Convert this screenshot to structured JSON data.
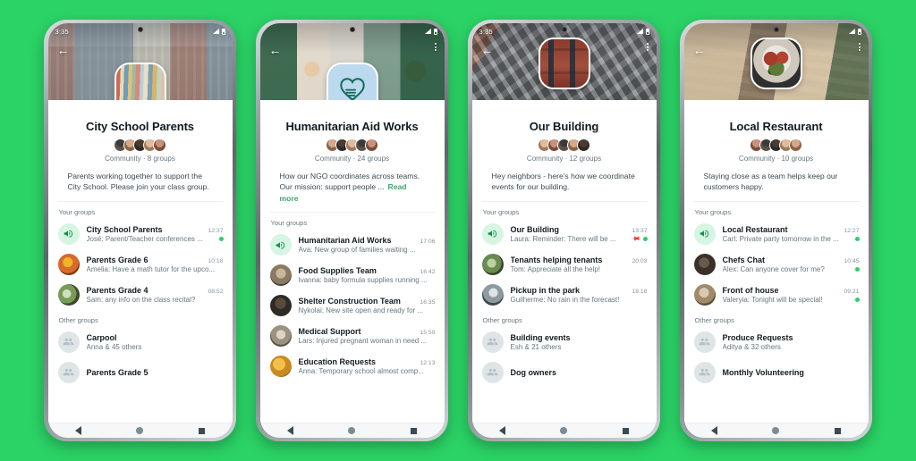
{
  "theme": {
    "background_green": "#2BD366",
    "accent_green": "#25D366",
    "link_green": "#3ca66f",
    "title_color": "#111b21",
    "secondary_text": "#667781"
  },
  "phones": [
    {
      "status": {
        "time": "3:35"
      },
      "community": {
        "title": "City School Parents",
        "meta": "Community · 8 groups",
        "description": "Parents working together to support the City School. Please join your class group.",
        "read_more": "",
        "avatar_icon": "books-cover-photo",
        "cover_icon": "school-building-photo"
      },
      "sections": [
        {
          "label": "Your groups",
          "rows": [
            {
              "title": "City School Parents",
              "time": "12:37",
              "subtitle": "José: Parent/Teacher conferences ...",
              "avatar": "announcement-megaphone-icon",
              "pinned": false,
              "unread": true
            },
            {
              "title": "Parents Grade 6",
              "time": "10:18",
              "subtitle": "Amelia: Have a math tutor for the upco...",
              "avatar": "group-photo",
              "pinned": false,
              "unread": false
            },
            {
              "title": "Parents Grade 4",
              "time": "08:52",
              "subtitle": "Sam: any info on the class recital?",
              "avatar": "group-photo",
              "pinned": false,
              "unread": false
            }
          ]
        },
        {
          "label": "Other groups",
          "rows": [
            {
              "title": "Carpool",
              "time": "",
              "subtitle": "Anna & 45 others",
              "avatar": "group-placeholder-icon",
              "pinned": false,
              "unread": false
            },
            {
              "title": "Parents Grade 5",
              "time": "",
              "subtitle": "",
              "avatar": "group-placeholder-icon",
              "pinned": false,
              "unread": false
            }
          ]
        }
      ]
    },
    {
      "status": {
        "time": ""
      },
      "community": {
        "title": "Humanitarian Aid Works",
        "meta": "Community · 24 groups",
        "description": "How our NGO coordinates across teams. Our mission: support people ...",
        "read_more": "Read more",
        "avatar_icon": "heart-hand-logo",
        "cover_icon": "volunteers-photo"
      },
      "sections": [
        {
          "label": "Your groups",
          "rows": [
            {
              "title": "Humanitarian Aid Works",
              "time": "17:06",
              "subtitle": "Ava: New group of families waiting ...",
              "avatar": "announcement-megaphone-icon",
              "pinned": false,
              "unread": false
            },
            {
              "title": "Food Supplies Team",
              "time": "16:42",
              "subtitle": "Ivanna: baby formula supplies running ...",
              "avatar": "group-photo",
              "pinned": false,
              "unread": false
            },
            {
              "title": "Shelter Construction Team",
              "time": "16:35",
              "subtitle": "Nykolai: New site open and ready for ...",
              "avatar": "group-photo",
              "pinned": false,
              "unread": false
            },
            {
              "title": "Medical Support",
              "time": "15:59",
              "subtitle": "Lars: Injured pregnant woman in need ...",
              "avatar": "group-photo",
              "pinned": false,
              "unread": false
            },
            {
              "title": "Education Requests",
              "time": "12:13",
              "subtitle": "Anna: Temporary school almost comp...",
              "avatar": "group-photo",
              "pinned": false,
              "unread": false
            }
          ]
        }
      ]
    },
    {
      "status": {
        "time": "3:35"
      },
      "community": {
        "title": "Our Building",
        "meta": "Community · 12 groups",
        "description": "Hey neighbors - here's how we coordinate events for our building.",
        "read_more": "",
        "avatar_icon": "brick-building-photo",
        "cover_icon": "aerial-city-photo"
      },
      "sections": [
        {
          "label": "Your groups",
          "rows": [
            {
              "title": "Our Building",
              "time": "13:37",
              "subtitle": "Laura: Reminder: There will be ...",
              "avatar": "announcement-megaphone-icon",
              "pinned": true,
              "unread": true
            },
            {
              "title": "Tenants helping tenants",
              "time": "20:03",
              "subtitle": "Tom: Appreciate all the help!",
              "avatar": "group-photo",
              "pinned": false,
              "unread": false
            },
            {
              "title": "Pickup in the park",
              "time": "18:18",
              "subtitle": "Guilherme: No rain in the forecast!",
              "avatar": "group-photo",
              "pinned": false,
              "unread": false
            }
          ]
        },
        {
          "label": "Other groups",
          "rows": [
            {
              "title": "Building events",
              "time": "",
              "subtitle": "Esh & 21 others",
              "avatar": "group-placeholder-icon",
              "pinned": false,
              "unread": false
            },
            {
              "title": "Dog owners",
              "time": "",
              "subtitle": "",
              "avatar": "group-placeholder-icon",
              "pinned": false,
              "unread": false
            }
          ]
        }
      ]
    },
    {
      "status": {
        "time": ""
      },
      "community": {
        "title": "Local Restaurant",
        "meta": "Community · 10 groups",
        "description": "Staying close as a team helps keep our customers happy.",
        "read_more": "",
        "avatar_icon": "plated-food-photo",
        "cover_icon": "restaurant-interior-photo"
      },
      "sections": [
        {
          "label": "Your groups",
          "rows": [
            {
              "title": "Local Restaurant",
              "time": "12:27",
              "subtitle": "Carl: Private party tomorrow in the ...",
              "avatar": "announcement-megaphone-icon",
              "pinned": false,
              "unread": true
            },
            {
              "title": "Chefs Chat",
              "time": "10:45",
              "subtitle": "Alex: Can anyone cover for me?",
              "avatar": "group-photo",
              "pinned": false,
              "unread": true
            },
            {
              "title": "Front of house",
              "time": "09:21",
              "subtitle": "Valeryia: Tonight will be special!",
              "avatar": "group-photo",
              "pinned": false,
              "unread": true
            }
          ]
        },
        {
          "label": "Other groups",
          "rows": [
            {
              "title": "Produce Requests",
              "time": "",
              "subtitle": "Aditya & 32 others",
              "avatar": "group-placeholder-icon",
              "pinned": false,
              "unread": false
            },
            {
              "title": "Monthly Volunteering",
              "time": "",
              "subtitle": "",
              "avatar": "group-placeholder-icon",
              "pinned": false,
              "unread": false
            }
          ]
        }
      ]
    }
  ],
  "navbar": {
    "back": "back-triangle-icon",
    "home": "home-circle-icon",
    "recents": "recents-square-icon"
  }
}
